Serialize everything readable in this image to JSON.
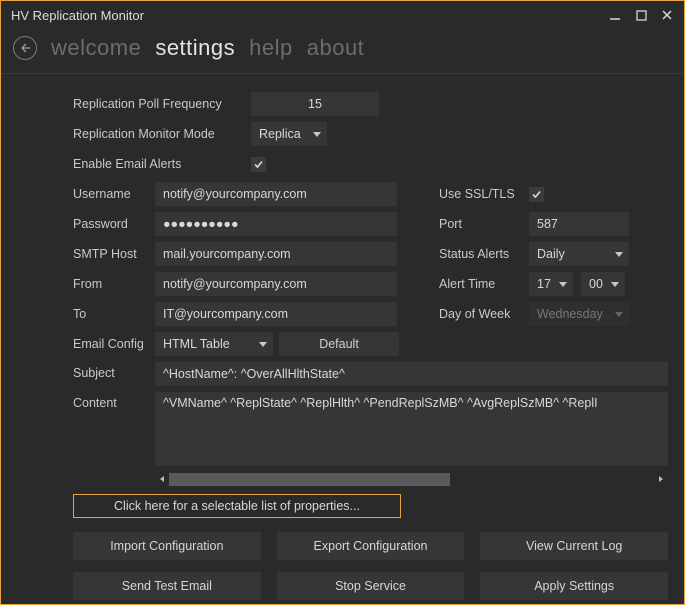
{
  "window": {
    "title": "HV Replication Monitor"
  },
  "nav": {
    "welcome": "welcome",
    "settings": "settings",
    "help": "help",
    "about": "about"
  },
  "labels": {
    "poll_freq": "Replication Poll Frequency",
    "monitor_mode": "Replication Monitor Mode",
    "enable_alerts": "Enable Email Alerts",
    "username": "Username",
    "password": "Password",
    "smtp_host": "SMTP Host",
    "from": "From",
    "to": "To",
    "email_config": "Email Config",
    "subject": "Subject",
    "content": "Content",
    "use_ssl": "Use SSL/TLS",
    "port": "Port",
    "status_alerts": "Status Alerts",
    "alert_time": "Alert Time",
    "day_of_week": "Day of Week"
  },
  "values": {
    "poll_freq": "15",
    "monitor_mode": "Replica",
    "enable_alerts": true,
    "username": "notify@yourcompany.com",
    "password": "●●●●●●●●●●",
    "smtp_host": "mail.yourcompany.com",
    "from": "notify@yourcompany.com",
    "to": "IT@yourcompany.com",
    "email_config": "HTML Table",
    "subject": "^HostName^: ^OverAllHlthState^",
    "content": "^VMName^ ^ReplState^ ^ReplHlth^ ^PendReplSzMB^ ^AvgReplSzMB^ ^ReplI",
    "use_ssl": true,
    "port": "587",
    "status_alerts": "Daily",
    "alert_hour": "17",
    "alert_min": "00",
    "day_of_week": "Wednesday"
  },
  "buttons": {
    "default": "Default",
    "props_link": "Click here for a selectable list of properties...",
    "import": "Import Configuration",
    "export": "Export Configuration",
    "view_log": "View Current Log",
    "send_test": "Send Test Email",
    "stop_svc": "Stop Service",
    "apply": "Apply Settings"
  }
}
